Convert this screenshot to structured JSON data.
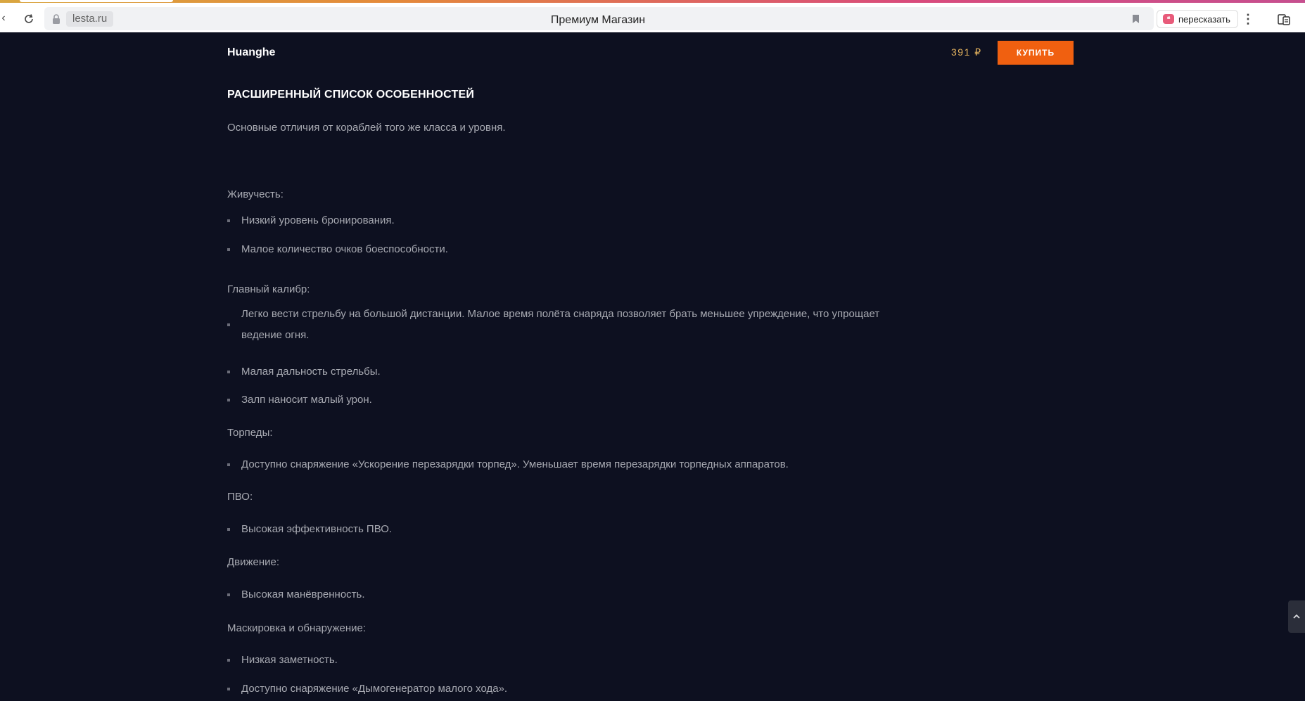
{
  "browser": {
    "domain": "lesta.ru",
    "tab_title": "Премиум Магазин",
    "retell_label": "пересказать"
  },
  "product": {
    "name": "Huanghe",
    "price": "391 ₽",
    "buy_label": "КУПИТЬ"
  },
  "features": {
    "heading": "РАСШИРЕННЫЙ СПИСОК ОСОБЕННОСТЕЙ",
    "intro": "Основные отличия от кораблей того же класса и уровня.",
    "groups": [
      {
        "title": "Живучесть:",
        "items": [
          "Низкий уровень бронирования.",
          "Малое количество очков боеспособности."
        ]
      },
      {
        "title": "Главный калибр:",
        "items": [
          "Легко вести стрельбу на большой дистанции. Малое время полёта снаряда позволяет брать меньшее упреждение, что упрощает ведение огня.",
          "Малая дальность стрельбы.",
          "Залп наносит малый урон."
        ]
      },
      {
        "title": "Торпеды:",
        "items": [
          "Доступно снаряжение «Ускорение перезарядки торпед». Уменьшает время перезарядки торпедных аппаратов."
        ]
      },
      {
        "title": "ПВО:",
        "items": [
          "Высокая эффективность ПВО."
        ]
      },
      {
        "title": "Движение:",
        "items": [
          "Высокая манёвренность."
        ]
      },
      {
        "title": "Маскировка и обнаружение:",
        "items": [
          "Низкая заметность.",
          "Доступно снаряжение «Дымогенератор малого хода»."
        ]
      }
    ]
  },
  "colors": {
    "page_bg": "#0d1020",
    "accent": "#f06010",
    "price": "#e3b25e",
    "text": "#a8aab2"
  }
}
